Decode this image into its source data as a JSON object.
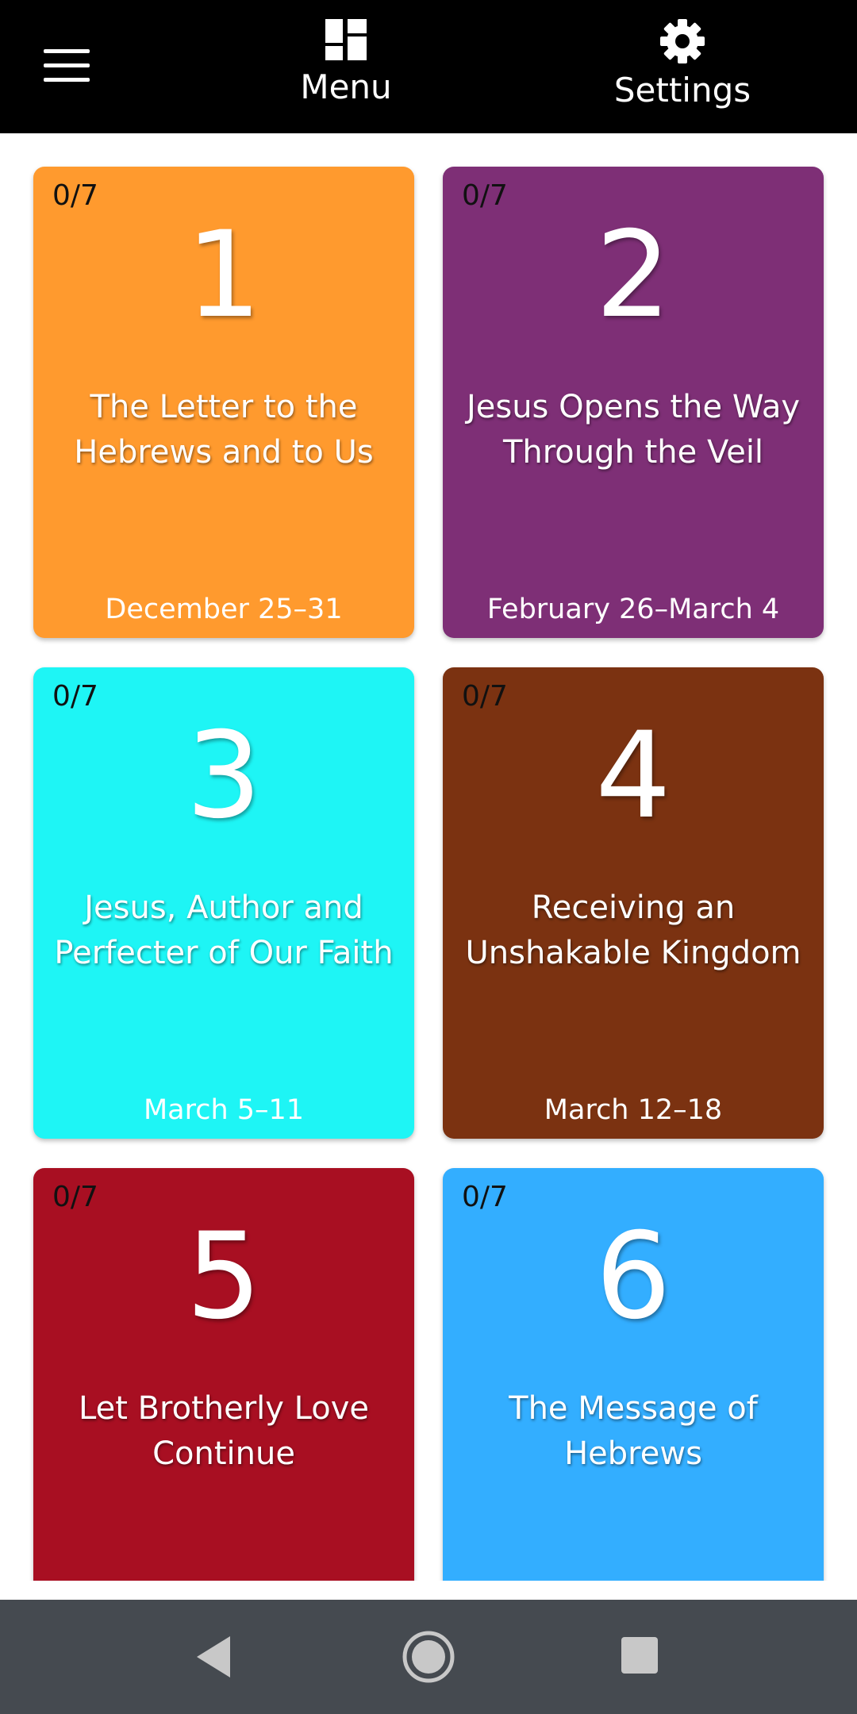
{
  "header": {
    "menu_label": "Menu",
    "settings_label": "Settings"
  },
  "cards": [
    {
      "progress": "0/7",
      "number": "1",
      "title": "The Letter to the Hebrews and to Us",
      "date": "December 25–31",
      "color": "#FF9A2E"
    },
    {
      "progress": "0/7",
      "number": "2",
      "title": "Jesus Opens the Way Through the Veil",
      "date": "February 26–March 4",
      "color": "#7E2F76"
    },
    {
      "progress": "0/7",
      "number": "3",
      "title": "Jesus, Author and Perfecter of Our Faith",
      "date": "March 5–11",
      "color": "#1EF5F5"
    },
    {
      "progress": "0/7",
      "number": "4",
      "title": "Receiving an Unshakable Kingdom",
      "date": "March 12–18",
      "color": "#7B3211"
    },
    {
      "progress": "0/7",
      "number": "5",
      "title": "Let Brotherly Love Continue",
      "date": "",
      "color": "#A80F22"
    },
    {
      "progress": "0/7",
      "number": "6",
      "title": "The Message of Hebrews",
      "date": "",
      "color": "#33AEFF"
    }
  ],
  "colors": {
    "topbar": "#000000",
    "system_nav": "#454A50"
  }
}
